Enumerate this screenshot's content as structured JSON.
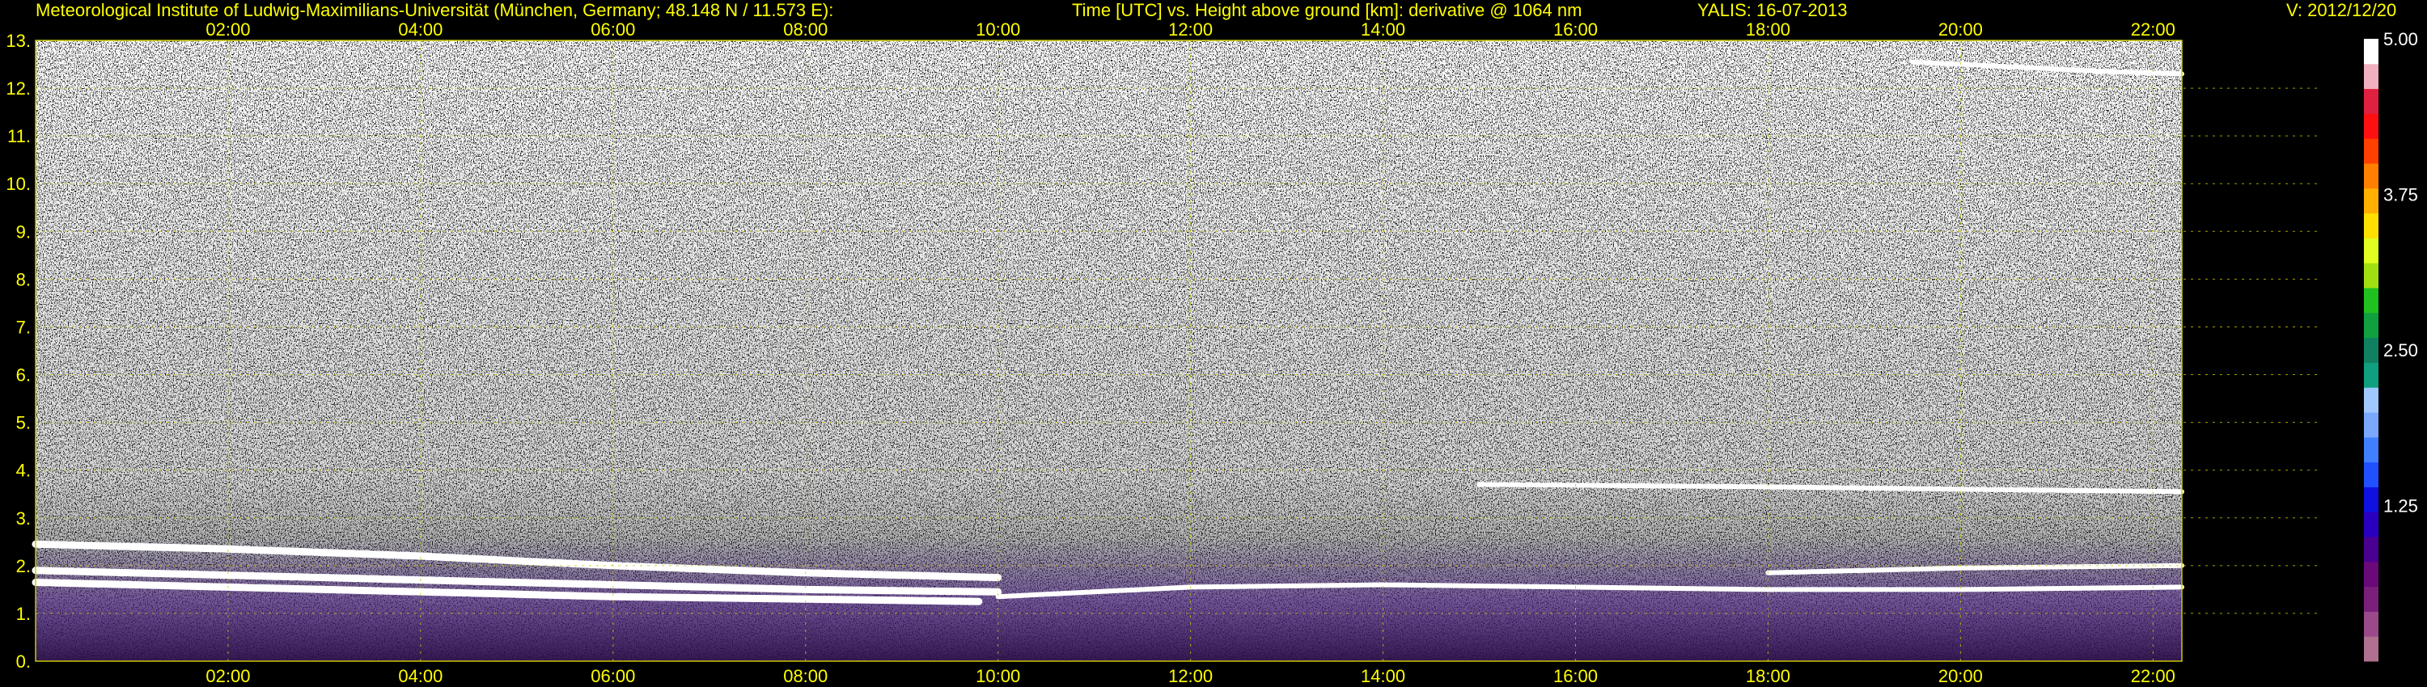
{
  "header": {
    "institute": "Meteorological Institute of Ludwig-Maximilians-Universität (München, Germany; 48.148 N / 11.573 E):",
    "description": "Time [UTC] vs. Height above ground [km]: derivative @ 1064 nm",
    "instrument_date": "YALIS: 16-07-2013",
    "version": "V: 2012/12/20"
  },
  "colors": {
    "background": "#000000",
    "text": "#ffff00",
    "grid": "#c8c800",
    "colorbar": [
      "#b07090",
      "#9a4a8a",
      "#7a1f7a",
      "#6a0a7a",
      "#4a0090",
      "#2a00c0",
      "#1010e0",
      "#2050ff",
      "#4080ff",
      "#7aa8ff",
      "#a0c8ff",
      "#10a080",
      "#108060",
      "#10a040",
      "#20c020",
      "#a0e010",
      "#e0ff20",
      "#ffe000",
      "#ffb000",
      "#ff8000",
      "#ff4000",
      "#ff1010",
      "#e02040",
      "#f0b0c0",
      "#ffffff"
    ]
  },
  "chart_data": {
    "type": "heatmap",
    "title": "Time [UTC] vs. Height above ground [km]: derivative @ 1064 nm",
    "xlabel": "Time [UTC]",
    "ylabel": "Height above ground [km]",
    "x_range_hours": [
      0.0,
      22.3
    ],
    "y_range_km": [
      0,
      13
    ],
    "x_ticks": [
      "02:00",
      "04:00",
      "06:00",
      "08:00",
      "10:00",
      "12:00",
      "14:00",
      "16:00",
      "18:00",
      "20:00",
      "22:00"
    ],
    "x_tick_hours": [
      2,
      4,
      6,
      8,
      10,
      12,
      14,
      16,
      18,
      20,
      22
    ],
    "y_ticks": [
      "0.",
      "1.",
      "2.",
      "3.",
      "4.",
      "5.",
      "6.",
      "7.",
      "8.",
      "9.",
      "10.",
      "11.",
      "12.",
      "13."
    ],
    "y_tick_values": [
      0,
      1,
      2,
      3,
      4,
      5,
      6,
      7,
      8,
      9,
      10,
      11,
      12,
      13
    ],
    "grid": true,
    "colorbar": {
      "range": [
        0,
        5.0
      ],
      "labels": [
        "1.25",
        "2.50",
        "3.75",
        "5.00"
      ],
      "label_values": [
        1.25,
        2.5,
        3.75,
        5.0
      ]
    },
    "layers": [
      {
        "hours": [
          0.0,
          2,
          4,
          6,
          8,
          10
        ],
        "heights_km": [
          2.45,
          2.35,
          2.2,
          2.0,
          1.85,
          1.75
        ]
      },
      {
        "hours": [
          0.0,
          2,
          4,
          6,
          8,
          10
        ],
        "heights_km": [
          1.9,
          1.8,
          1.7,
          1.6,
          1.5,
          1.45
        ]
      },
      {
        "hours": [
          0.0,
          2,
          4,
          6,
          8,
          9.8
        ],
        "heights_km": [
          1.65,
          1.55,
          1.45,
          1.35,
          1.3,
          1.25
        ]
      },
      {
        "hours": [
          10,
          12,
          14,
          16,
          18,
          20,
          22.3
        ],
        "heights_km": [
          1.35,
          1.55,
          1.6,
          1.55,
          1.5,
          1.5,
          1.55
        ]
      },
      {
        "hours": [
          18,
          20,
          22.3
        ],
        "heights_km": [
          1.85,
          1.95,
          2.0
        ]
      },
      {
        "hours": [
          15,
          18,
          20,
          22.3
        ],
        "heights_km": [
          3.7,
          3.65,
          3.6,
          3.55
        ]
      },
      {
        "hours": [
          19.5,
          20.5,
          21.5,
          22.3
        ],
        "heights_km": [
          12.55,
          12.45,
          12.35,
          12.3
        ]
      }
    ]
  }
}
